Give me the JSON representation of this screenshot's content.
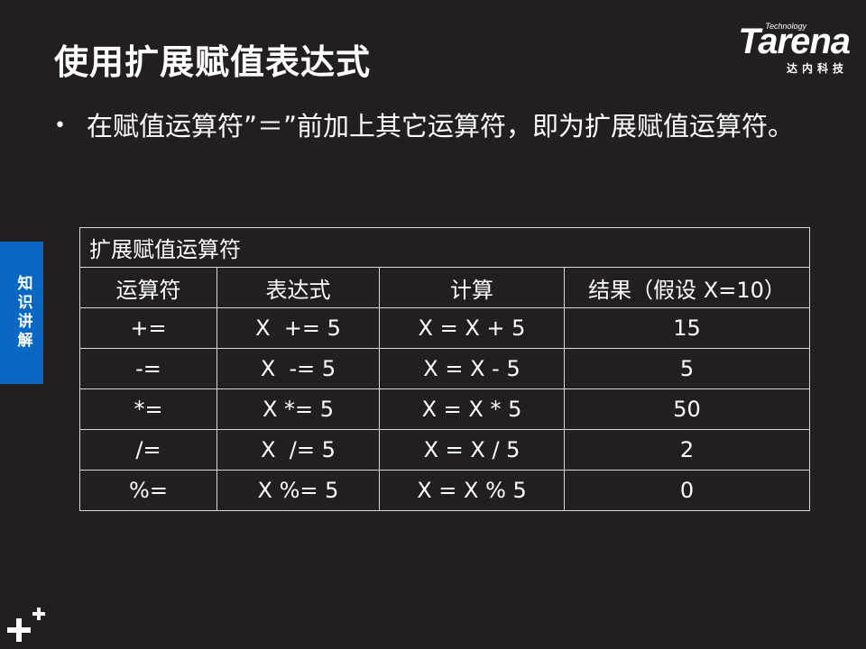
{
  "title": "使用扩展赋值表达式",
  "logo": {
    "technology": "Technology",
    "brand": "Tarena",
    "cn": "达内科技"
  },
  "bullet": {
    "text": "在赋值运算符”＝”前加上其它运算符，即为扩展赋值运算符。"
  },
  "side_tab": "知识讲解",
  "table": {
    "caption": "扩展赋值运算符",
    "headers": [
      "运算符",
      "表达式",
      "计算",
      "结果（假设 X=10）"
    ],
    "rows": [
      [
        "+=",
        "X  += 5",
        "X = X + 5",
        "15"
      ],
      [
        "-=",
        "X  -= 5",
        "X = X - 5",
        "5"
      ],
      [
        "*=",
        "X *= 5",
        "X = X * 5",
        "50"
      ],
      [
        "/=",
        "X  /= 5",
        "X = X / 5",
        "2"
      ],
      [
        "%=",
        "X %= 5",
        "X = X % 5",
        "0"
      ]
    ]
  }
}
